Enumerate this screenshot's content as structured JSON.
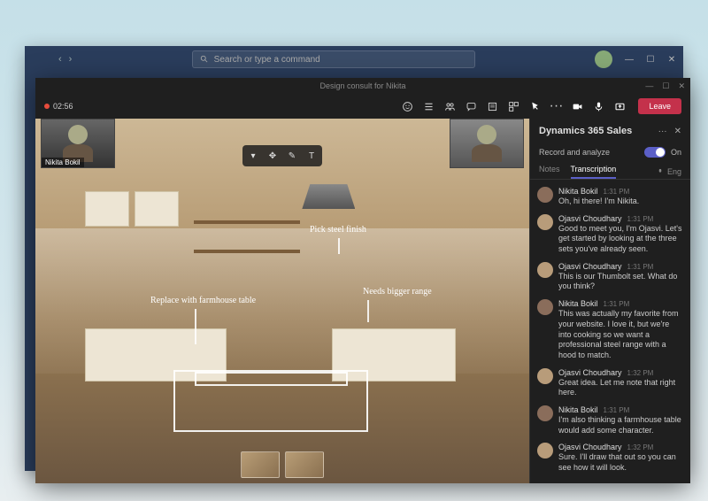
{
  "outer_window": {
    "search_placeholder": "Search or type a command"
  },
  "meeting": {
    "title": "Design consult for Nikita",
    "rec_time": "02:56",
    "leave_label": "Leave",
    "participants": {
      "p1_name": "Nikita Bokil"
    },
    "annotations": {
      "a1": "Replace with farmhouse table",
      "a2": "Pick steel finish",
      "a3": "Needs bigger range"
    }
  },
  "panel": {
    "title": "Dynamics 365 Sales",
    "record_label": "Record and analyze",
    "toggle_state": "On",
    "tab_notes": "Notes",
    "tab_transcription": "Transcription",
    "language": "Eng",
    "messages": [
      {
        "avatar": "nb",
        "name": "Nikita Bokil",
        "time": "1:31 PM",
        "text": "Oh, hi there! I'm Nikita."
      },
      {
        "avatar": "oc",
        "name": "Ojasvi Choudhary",
        "time": "1:31 PM",
        "text": "Good to meet you, I'm Ojasvi. Let's get started by looking at the three sets you've already seen."
      },
      {
        "avatar": "oc",
        "name": "Ojasvi Choudhary",
        "time": "1:31 PM",
        "text": "This is our Thumbolt set. What do you think?"
      },
      {
        "avatar": "nb",
        "name": "Nikita Bokil",
        "time": "1:31 PM",
        "text": "This was actually my favorite from your website. I love it, but we're into cooking so we want a professional steel range with a hood to match."
      },
      {
        "avatar": "oc",
        "name": "Ojasvi Choudhary",
        "time": "1:32 PM",
        "text": "Great idea. Let me note that right here."
      },
      {
        "avatar": "nb",
        "name": "Nikita Bokil",
        "time": "1:31 PM",
        "text": "I'm also thinking a farmhouse table would add some character."
      },
      {
        "avatar": "oc",
        "name": "Ojasvi Choudhary",
        "time": "1:32 PM",
        "text": "Sure. I'll draw that out so you can see how it will look."
      }
    ]
  }
}
